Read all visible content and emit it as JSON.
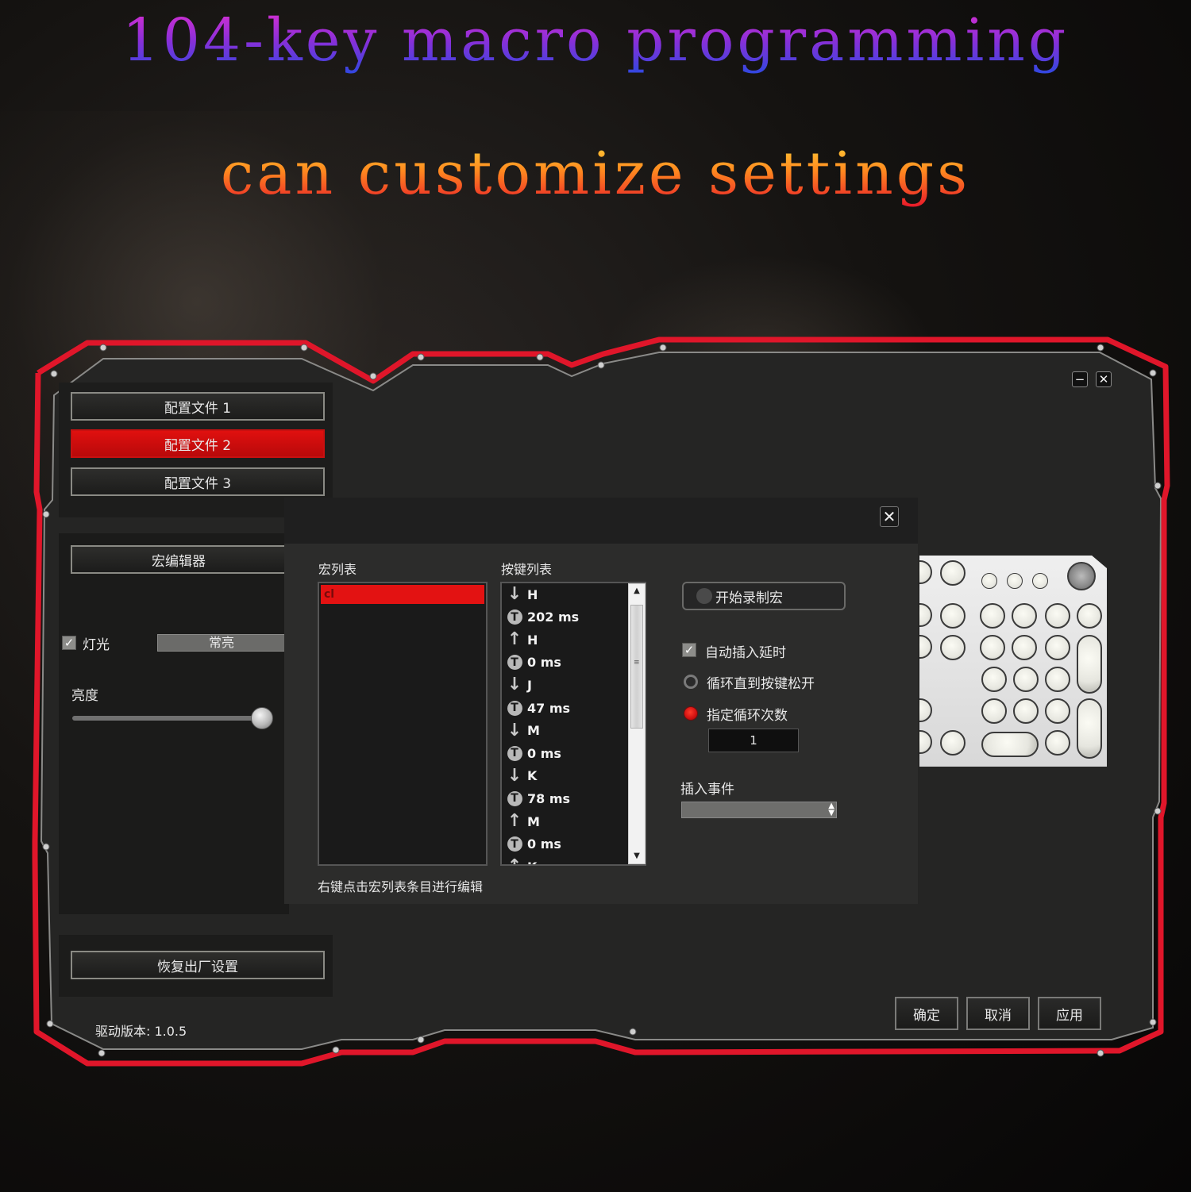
{
  "headline": {
    "line1": "104-key macro programming",
    "line2": "can customize settings"
  },
  "window": {
    "minimize_icon": "minimize-icon",
    "close_icon": "close-icon"
  },
  "profiles": [
    {
      "label": "配置文件 1",
      "active": false
    },
    {
      "label": "配置文件 2",
      "active": true
    },
    {
      "label": "配置文件 3",
      "active": false
    }
  ],
  "macro_editor_button": "宏编辑器",
  "lighting": {
    "checkbox_label": "灯光",
    "checked": true,
    "mode": "常亮",
    "brightness_label": "亮度",
    "brightness_percent": 95
  },
  "restore_button": "恢复出厂设置",
  "driver_version": "驱动版本: 1.0.5",
  "macro_dialog": {
    "close_icon": "close-icon",
    "macro_list_label": "宏列表",
    "macro_list": [
      "cl"
    ],
    "key_list_label": "按键列表",
    "key_list": [
      {
        "type": "down",
        "text": "H"
      },
      {
        "type": "delay",
        "text": "202 ms"
      },
      {
        "type": "up",
        "text": "H"
      },
      {
        "type": "delay",
        "text": "0 ms"
      },
      {
        "type": "down",
        "text": "J"
      },
      {
        "type": "delay",
        "text": "47 ms"
      },
      {
        "type": "down",
        "text": "M"
      },
      {
        "type": "delay",
        "text": "0 ms"
      },
      {
        "type": "down",
        "text": "K"
      },
      {
        "type": "delay",
        "text": "78 ms"
      },
      {
        "type": "up",
        "text": "M"
      },
      {
        "type": "delay",
        "text": "0 ms"
      },
      {
        "type": "up",
        "text": "K"
      }
    ],
    "hint": "右键点击宏列表条目进行编辑",
    "record_button": "开始录制宏",
    "auto_insert_delay": {
      "label": "自动插入延时",
      "checked": true
    },
    "loop_until_release": {
      "label": "循环直到按键松开",
      "selected": false
    },
    "loop_count": {
      "label": "指定循环次数",
      "selected": true,
      "value": "1"
    },
    "insert_event_label": "插入事件",
    "insert_event_value": ""
  },
  "footer": {
    "ok": "确定",
    "cancel": "取消",
    "apply": "应用"
  },
  "colors": {
    "accent_red": "#e01010",
    "frame_red": "#e0162a",
    "panel_bg": "#232322"
  }
}
